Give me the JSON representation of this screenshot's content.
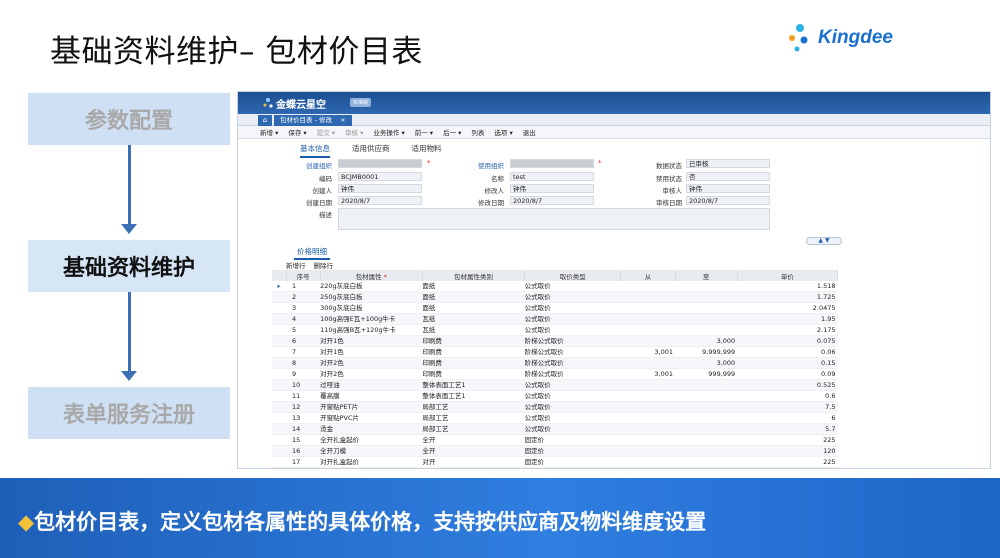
{
  "slide": {
    "title": "基础资料维护– 包材价目表",
    "logo_text": "Kingdee",
    "flow": [
      {
        "label": "参数配置",
        "state": "dim"
      },
      {
        "label": "基础资料维护",
        "state": "active"
      },
      {
        "label": "表单服务注册",
        "state": "dim"
      }
    ],
    "banner": "包材价目表，定义包材各属性的具体价格，支持按供应商及物料维度设置",
    "banner_bullet": "◆"
  },
  "app": {
    "brand": "金蝶云星空",
    "brand_tag": "标准版",
    "home_icon": "home-icon",
    "doc_tab": "包材价目表 - 修改",
    "doc_tab_close": "×",
    "toolbar": [
      "新增 ▾",
      "保存 ▾",
      "提交 ▾",
      "审核 ▾",
      "业务操作 ▾",
      "前一 ▾",
      "后一 ▾",
      "列表",
      "选项 ▾",
      "退出"
    ],
    "toolbar_disabled": [
      2,
      3
    ],
    "tabs": [
      "基本信息",
      "适用供应商",
      "适用物料"
    ],
    "form": {
      "create_org_label": "创建组织",
      "create_org_value": "",
      "use_org_label": "使用组织",
      "use_org_value": "",
      "status_label": "数据状态",
      "status_value": "已审核",
      "code_label": "编码",
      "code_value": "BCJMB0001",
      "name_label": "名称",
      "name_value": "test",
      "forbid_label": "禁用状态",
      "forbid_value": "否",
      "creator_label": "创建人",
      "creator_value": "钟伟",
      "modifier_label": "修改人",
      "modifier_value": "钟伟",
      "auditor_label": "审核人",
      "auditor_value": "钟伟",
      "create_date_label": "创建日期",
      "create_date_value": "2020/8/7",
      "modify_date_label": "修改日期",
      "modify_date_value": "2020/8/7",
      "audit_date_label": "审核日期",
      "audit_date_value": "2020/8/7",
      "desc_label": "描述"
    },
    "section_title": "价格明细",
    "grid_actions": [
      "新增行",
      "删除行"
    ],
    "grid_headers": [
      "序号",
      "包材属性",
      "包材属性类别",
      "取价类型",
      "从",
      "至",
      "单价"
    ],
    "grid_rows": [
      [
        "1",
        "220g灰底白板",
        "面纸",
        "公式取价",
        "",
        "",
        "1.518"
      ],
      [
        "2",
        "250g灰底白板",
        "面纸",
        "公式取价",
        "",
        "",
        "1.725"
      ],
      [
        "3",
        "300g灰底白板",
        "面纸",
        "公式取价",
        "",
        "",
        "2.0475"
      ],
      [
        "4",
        "100g高强E瓦+100g牛卡",
        "瓦纸",
        "公式取价",
        "",
        "",
        "1.95"
      ],
      [
        "5",
        "110g高强B瓦+120g牛卡",
        "瓦纸",
        "公式取价",
        "",
        "",
        "2.175"
      ],
      [
        "6",
        "对开1色",
        "印刷费",
        "阶梯公式取价",
        "",
        "3,000",
        "0.075"
      ],
      [
        "7",
        "对开1色",
        "印刷费",
        "阶梯公式取价",
        "3,001",
        "9,999,999",
        "0.06"
      ],
      [
        "8",
        "对开2色",
        "印刷费",
        "阶梯公式取价",
        "",
        "3,000",
        "0.15"
      ],
      [
        "9",
        "对开2色",
        "印刷费",
        "阶梯公式取价",
        "3,001",
        "999,999",
        "0.09"
      ],
      [
        "10",
        "过哑油",
        "整体表面工艺1",
        "公式取价",
        "",
        "",
        "0.525"
      ],
      [
        "11",
        "覆高膜",
        "整体表面工艺1",
        "公式取价",
        "",
        "",
        "0.6"
      ],
      [
        "12",
        "开窗贴PET片",
        "局部工艺",
        "公式取价",
        "",
        "",
        "7.5"
      ],
      [
        "13",
        "开窗贴PVC片",
        "局部工艺",
        "公式取价",
        "",
        "",
        "6"
      ],
      [
        "14",
        "烫金",
        "局部工艺",
        "公式取价",
        "",
        "",
        "5.7"
      ],
      [
        "15",
        "全开扎盒起价",
        "全开",
        "固定价",
        "",
        "",
        "225"
      ],
      [
        "16",
        "全开刀模",
        "全开",
        "固定价",
        "",
        "",
        "120"
      ],
      [
        "17",
        "对开扎盒起价",
        "对开",
        "固定价",
        "",
        "",
        "225"
      ]
    ]
  }
}
